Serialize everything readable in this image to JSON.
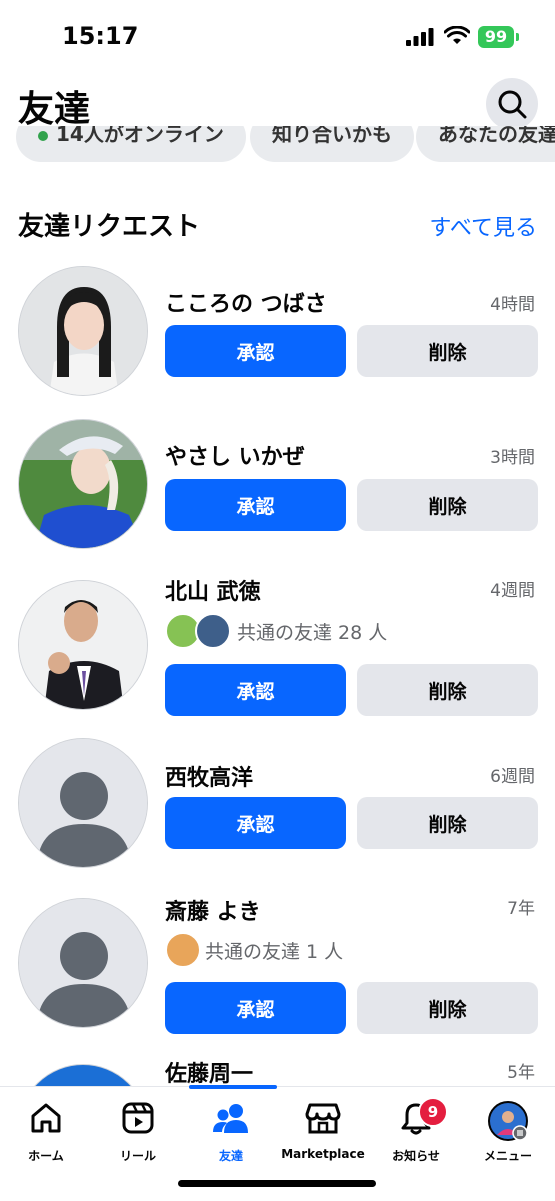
{
  "status": {
    "time": "15:17",
    "battery": "99"
  },
  "header": {
    "title": "友達"
  },
  "chips": [
    {
      "label": "14人がオンライン"
    },
    {
      "label": "知り合いかも"
    },
    {
      "label": "あなたの友達"
    }
  ],
  "section": {
    "title": "友達リクエスト",
    "see_all": "すべて見る"
  },
  "requests": [
    {
      "name": "こころの つばさ",
      "time": "4時間",
      "mutual": "",
      "approve": "承認",
      "delete": "削除"
    },
    {
      "name": "やさし いかぜ",
      "time": "3時間",
      "mutual": "",
      "approve": "承認",
      "delete": "削除"
    },
    {
      "name": "北山 武徳",
      "time": "4週間",
      "mutual": "共通の友達 28 人",
      "approve": "承認",
      "delete": "削除"
    },
    {
      "name": "西牧高洋",
      "time": "6週間",
      "mutual": "",
      "approve": "承認",
      "delete": "削除"
    },
    {
      "name": "斎藤 よき",
      "time": "7年",
      "mutual": "共通の友達 1 人",
      "approve": "承認",
      "delete": "削除"
    },
    {
      "name": "佐藤周一",
      "time": "5年",
      "mutual": "",
      "approve": "",
      "delete": ""
    }
  ],
  "tabs": [
    {
      "label": "ホーム",
      "icon": "home-icon"
    },
    {
      "label": "リール",
      "icon": "reels-icon"
    },
    {
      "label": "友達",
      "icon": "friends-icon"
    },
    {
      "label": "Marketplace",
      "icon": "marketplace-icon"
    },
    {
      "label": "お知らせ",
      "icon": "bell-icon",
      "badge": "9"
    },
    {
      "label": "メニュー",
      "icon": "menu-avatar-icon"
    }
  ],
  "colors": {
    "accent": "#0866ff",
    "badge": "#e41e3f",
    "online": "#31a24c"
  }
}
